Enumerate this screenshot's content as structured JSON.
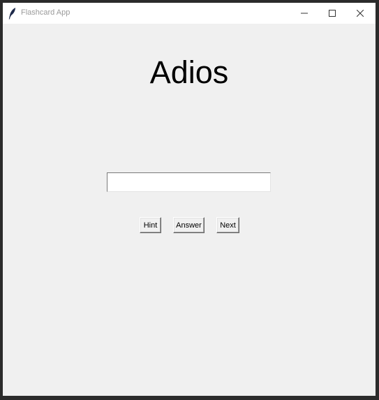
{
  "window": {
    "title": "Flashcard App",
    "icon": "feather-icon"
  },
  "card": {
    "word": "Adios"
  },
  "answer_input": {
    "value": "",
    "placeholder": ""
  },
  "buttons": {
    "hint_label": "Hint",
    "answer_label": "Answer",
    "next_label": "Next"
  }
}
